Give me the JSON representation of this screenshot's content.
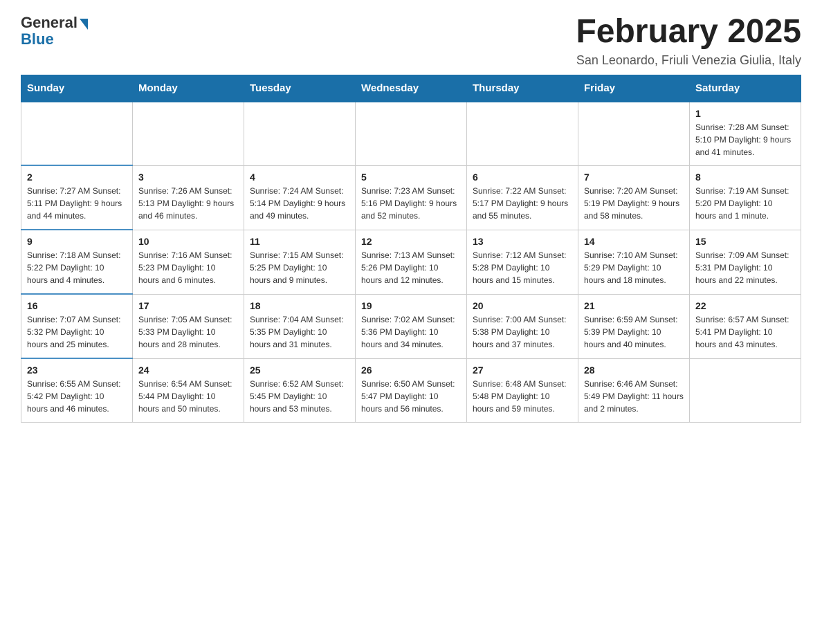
{
  "header": {
    "logo_general": "General",
    "logo_blue": "Blue",
    "month_title": "February 2025",
    "location": "San Leonardo, Friuli Venezia Giulia, Italy"
  },
  "days_of_week": [
    "Sunday",
    "Monday",
    "Tuesday",
    "Wednesday",
    "Thursday",
    "Friday",
    "Saturday"
  ],
  "weeks": [
    [
      {
        "day": "",
        "info": ""
      },
      {
        "day": "",
        "info": ""
      },
      {
        "day": "",
        "info": ""
      },
      {
        "day": "",
        "info": ""
      },
      {
        "day": "",
        "info": ""
      },
      {
        "day": "",
        "info": ""
      },
      {
        "day": "1",
        "info": "Sunrise: 7:28 AM\nSunset: 5:10 PM\nDaylight: 9 hours and 41 minutes."
      }
    ],
    [
      {
        "day": "2",
        "info": "Sunrise: 7:27 AM\nSunset: 5:11 PM\nDaylight: 9 hours and 44 minutes."
      },
      {
        "day": "3",
        "info": "Sunrise: 7:26 AM\nSunset: 5:13 PM\nDaylight: 9 hours and 46 minutes."
      },
      {
        "day": "4",
        "info": "Sunrise: 7:24 AM\nSunset: 5:14 PM\nDaylight: 9 hours and 49 minutes."
      },
      {
        "day": "5",
        "info": "Sunrise: 7:23 AM\nSunset: 5:16 PM\nDaylight: 9 hours and 52 minutes."
      },
      {
        "day": "6",
        "info": "Sunrise: 7:22 AM\nSunset: 5:17 PM\nDaylight: 9 hours and 55 minutes."
      },
      {
        "day": "7",
        "info": "Sunrise: 7:20 AM\nSunset: 5:19 PM\nDaylight: 9 hours and 58 minutes."
      },
      {
        "day": "8",
        "info": "Sunrise: 7:19 AM\nSunset: 5:20 PM\nDaylight: 10 hours and 1 minute."
      }
    ],
    [
      {
        "day": "9",
        "info": "Sunrise: 7:18 AM\nSunset: 5:22 PM\nDaylight: 10 hours and 4 minutes."
      },
      {
        "day": "10",
        "info": "Sunrise: 7:16 AM\nSunset: 5:23 PM\nDaylight: 10 hours and 6 minutes."
      },
      {
        "day": "11",
        "info": "Sunrise: 7:15 AM\nSunset: 5:25 PM\nDaylight: 10 hours and 9 minutes."
      },
      {
        "day": "12",
        "info": "Sunrise: 7:13 AM\nSunset: 5:26 PM\nDaylight: 10 hours and 12 minutes."
      },
      {
        "day": "13",
        "info": "Sunrise: 7:12 AM\nSunset: 5:28 PM\nDaylight: 10 hours and 15 minutes."
      },
      {
        "day": "14",
        "info": "Sunrise: 7:10 AM\nSunset: 5:29 PM\nDaylight: 10 hours and 18 minutes."
      },
      {
        "day": "15",
        "info": "Sunrise: 7:09 AM\nSunset: 5:31 PM\nDaylight: 10 hours and 22 minutes."
      }
    ],
    [
      {
        "day": "16",
        "info": "Sunrise: 7:07 AM\nSunset: 5:32 PM\nDaylight: 10 hours and 25 minutes."
      },
      {
        "day": "17",
        "info": "Sunrise: 7:05 AM\nSunset: 5:33 PM\nDaylight: 10 hours and 28 minutes."
      },
      {
        "day": "18",
        "info": "Sunrise: 7:04 AM\nSunset: 5:35 PM\nDaylight: 10 hours and 31 minutes."
      },
      {
        "day": "19",
        "info": "Sunrise: 7:02 AM\nSunset: 5:36 PM\nDaylight: 10 hours and 34 minutes."
      },
      {
        "day": "20",
        "info": "Sunrise: 7:00 AM\nSunset: 5:38 PM\nDaylight: 10 hours and 37 minutes."
      },
      {
        "day": "21",
        "info": "Sunrise: 6:59 AM\nSunset: 5:39 PM\nDaylight: 10 hours and 40 minutes."
      },
      {
        "day": "22",
        "info": "Sunrise: 6:57 AM\nSunset: 5:41 PM\nDaylight: 10 hours and 43 minutes."
      }
    ],
    [
      {
        "day": "23",
        "info": "Sunrise: 6:55 AM\nSunset: 5:42 PM\nDaylight: 10 hours and 46 minutes."
      },
      {
        "day": "24",
        "info": "Sunrise: 6:54 AM\nSunset: 5:44 PM\nDaylight: 10 hours and 50 minutes."
      },
      {
        "day": "25",
        "info": "Sunrise: 6:52 AM\nSunset: 5:45 PM\nDaylight: 10 hours and 53 minutes."
      },
      {
        "day": "26",
        "info": "Sunrise: 6:50 AM\nSunset: 5:47 PM\nDaylight: 10 hours and 56 minutes."
      },
      {
        "day": "27",
        "info": "Sunrise: 6:48 AM\nSunset: 5:48 PM\nDaylight: 10 hours and 59 minutes."
      },
      {
        "day": "28",
        "info": "Sunrise: 6:46 AM\nSunset: 5:49 PM\nDaylight: 11 hours and 2 minutes."
      },
      {
        "day": "",
        "info": ""
      }
    ]
  ]
}
